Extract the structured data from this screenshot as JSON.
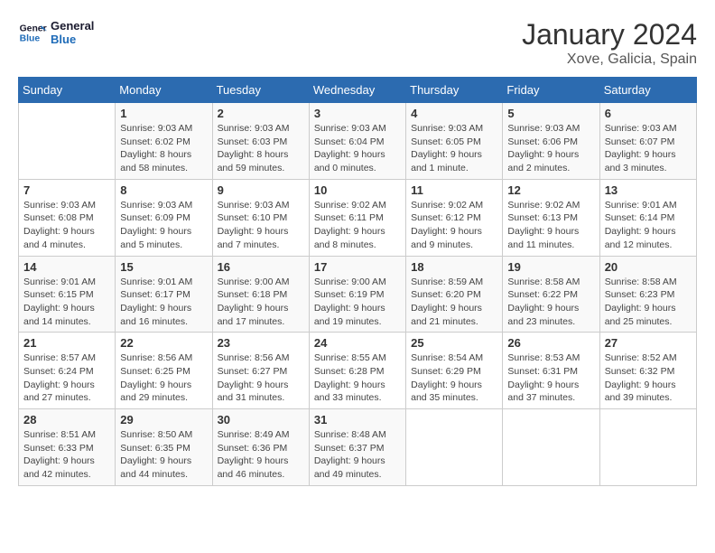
{
  "header": {
    "logo_general": "General",
    "logo_blue": "Blue",
    "month_year": "January 2024",
    "location": "Xove, Galicia, Spain"
  },
  "weekdays": [
    "Sunday",
    "Monday",
    "Tuesday",
    "Wednesday",
    "Thursday",
    "Friday",
    "Saturday"
  ],
  "weeks": [
    [
      null,
      {
        "day": "1",
        "sunrise": "9:03 AM",
        "sunset": "6:02 PM",
        "daylight": "8 hours and 58 minutes."
      },
      {
        "day": "2",
        "sunrise": "9:03 AM",
        "sunset": "6:03 PM",
        "daylight": "8 hours and 59 minutes."
      },
      {
        "day": "3",
        "sunrise": "9:03 AM",
        "sunset": "6:04 PM",
        "daylight": "9 hours and 0 minutes."
      },
      {
        "day": "4",
        "sunrise": "9:03 AM",
        "sunset": "6:05 PM",
        "daylight": "9 hours and 1 minute."
      },
      {
        "day": "5",
        "sunrise": "9:03 AM",
        "sunset": "6:06 PM",
        "daylight": "9 hours and 2 minutes."
      },
      {
        "day": "6",
        "sunrise": "9:03 AM",
        "sunset": "6:07 PM",
        "daylight": "9 hours and 3 minutes."
      }
    ],
    [
      {
        "day": "7",
        "sunrise": "9:03 AM",
        "sunset": "6:08 PM",
        "daylight": "9 hours and 4 minutes."
      },
      {
        "day": "8",
        "sunrise": "9:03 AM",
        "sunset": "6:09 PM",
        "daylight": "9 hours and 5 minutes."
      },
      {
        "day": "9",
        "sunrise": "9:03 AM",
        "sunset": "6:10 PM",
        "daylight": "9 hours and 7 minutes."
      },
      {
        "day": "10",
        "sunrise": "9:02 AM",
        "sunset": "6:11 PM",
        "daylight": "9 hours and 8 minutes."
      },
      {
        "day": "11",
        "sunrise": "9:02 AM",
        "sunset": "6:12 PM",
        "daylight": "9 hours and 9 minutes."
      },
      {
        "day": "12",
        "sunrise": "9:02 AM",
        "sunset": "6:13 PM",
        "daylight": "9 hours and 11 minutes."
      },
      {
        "day": "13",
        "sunrise": "9:01 AM",
        "sunset": "6:14 PM",
        "daylight": "9 hours and 12 minutes."
      }
    ],
    [
      {
        "day": "14",
        "sunrise": "9:01 AM",
        "sunset": "6:15 PM",
        "daylight": "9 hours and 14 minutes."
      },
      {
        "day": "15",
        "sunrise": "9:01 AM",
        "sunset": "6:17 PM",
        "daylight": "9 hours and 16 minutes."
      },
      {
        "day": "16",
        "sunrise": "9:00 AM",
        "sunset": "6:18 PM",
        "daylight": "9 hours and 17 minutes."
      },
      {
        "day": "17",
        "sunrise": "9:00 AM",
        "sunset": "6:19 PM",
        "daylight": "9 hours and 19 minutes."
      },
      {
        "day": "18",
        "sunrise": "8:59 AM",
        "sunset": "6:20 PM",
        "daylight": "9 hours and 21 minutes."
      },
      {
        "day": "19",
        "sunrise": "8:58 AM",
        "sunset": "6:22 PM",
        "daylight": "9 hours and 23 minutes."
      },
      {
        "day": "20",
        "sunrise": "8:58 AM",
        "sunset": "6:23 PM",
        "daylight": "9 hours and 25 minutes."
      }
    ],
    [
      {
        "day": "21",
        "sunrise": "8:57 AM",
        "sunset": "6:24 PM",
        "daylight": "9 hours and 27 minutes."
      },
      {
        "day": "22",
        "sunrise": "8:56 AM",
        "sunset": "6:25 PM",
        "daylight": "9 hours and 29 minutes."
      },
      {
        "day": "23",
        "sunrise": "8:56 AM",
        "sunset": "6:27 PM",
        "daylight": "9 hours and 31 minutes."
      },
      {
        "day": "24",
        "sunrise": "8:55 AM",
        "sunset": "6:28 PM",
        "daylight": "9 hours and 33 minutes."
      },
      {
        "day": "25",
        "sunrise": "8:54 AM",
        "sunset": "6:29 PM",
        "daylight": "9 hours and 35 minutes."
      },
      {
        "day": "26",
        "sunrise": "8:53 AM",
        "sunset": "6:31 PM",
        "daylight": "9 hours and 37 minutes."
      },
      {
        "day": "27",
        "sunrise": "8:52 AM",
        "sunset": "6:32 PM",
        "daylight": "9 hours and 39 minutes."
      }
    ],
    [
      {
        "day": "28",
        "sunrise": "8:51 AM",
        "sunset": "6:33 PM",
        "daylight": "9 hours and 42 minutes."
      },
      {
        "day": "29",
        "sunrise": "8:50 AM",
        "sunset": "6:35 PM",
        "daylight": "9 hours and 44 minutes."
      },
      {
        "day": "30",
        "sunrise": "8:49 AM",
        "sunset": "6:36 PM",
        "daylight": "9 hours and 46 minutes."
      },
      {
        "day": "31",
        "sunrise": "8:48 AM",
        "sunset": "6:37 PM",
        "daylight": "9 hours and 49 minutes."
      },
      null,
      null,
      null
    ]
  ]
}
